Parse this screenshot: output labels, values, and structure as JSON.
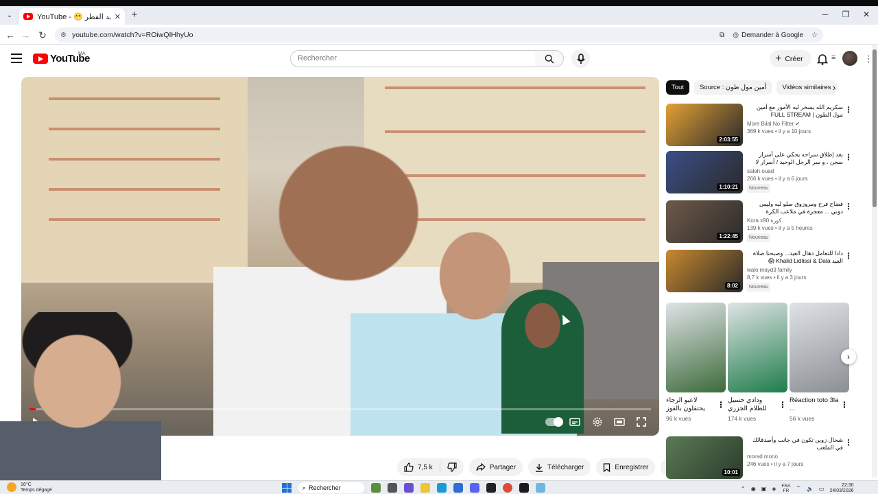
{
  "browser": {
    "tab_title": "YouTube - 😬 اجواء عيد الفطر",
    "url": "youtube.com/watch?v=ROiwQIHhyUo",
    "ask_google": "Demander à Google",
    "profile_initial": "H"
  },
  "youtube": {
    "logo_text": "YouTube",
    "region": "MA",
    "search_placeholder": "Rechercher",
    "create_label": "Créer"
  },
  "player": {
    "progress_fraction": 0.01
  },
  "actions": {
    "likes": "7,5 k",
    "share": "Partager",
    "download": "Télécharger",
    "save": "Enregistrer"
  },
  "chips": [
    "Tout",
    "Source : أمين مول طون",
    "Vidéos similaires"
  ],
  "recommendations": [
    {
      "title": "سكريم الله يسخر ليه الأمور مع أمين مول الطون | FULL STREAM",
      "channel": "More Bilal No Filter",
      "verified": true,
      "meta": "369 k vues • il y a 10 jours",
      "duration": "2:03:55",
      "badge": "",
      "thumb": "#e3a035"
    },
    {
      "title": "بعد إطلاق سراحه يحكي على أسرار سجن ، و سر الرجل الوحيد / أسرار لا تقال",
      "channel": "salah ouad",
      "verified": false,
      "meta": "266 k vues • il y a 6 jours",
      "duration": "1:10:21",
      "badge": "Nouveau",
      "thumb": "#3a4f86"
    },
    {
      "title": "فضاح فرح ومروزوق صلو ليه وليس دوتي ... معجزة في ملاعب الكرة",
      "channel": "Kora x90 كورة",
      "verified": false,
      "meta": "139 k vues • il y a 5 heures",
      "duration": "1:22:45",
      "badge": "Nouveau",
      "thumb": "#6e5a4a"
    },
    {
      "title": "دادا للتعامل دهال العيد... وصبحنا صلاة العيد Khalid Lidlissi & Dala 😱",
      "channel": "walo mayd3 family",
      "verified": false,
      "meta": "8,7 k vues • il y a 3 jours",
      "duration": "8:02",
      "badge": "Nouveau",
      "thumb": "#c98a2e"
    }
  ],
  "shorts": [
    {
      "title": "لاعبو الرجاء يحتفلون بالفوز",
      "views": "96 k vues",
      "thumb": "#3c6b3a"
    },
    {
      "title": "ودادي حسيل للطلام الجزري",
      "views": "174 k vues",
      "thumb": "#1f7d4a"
    },
    {
      "title": "Réaction toto 3la ...",
      "views": "56 k vues",
      "thumb": "#8b8f95"
    }
  ],
  "bottom_rec": {
    "title": "شحال زوين تكون في جانب وأصدقائك في الملعب",
    "channel": "morad mono",
    "meta": "246 vues • il y a 7 jours",
    "duration": "10:01",
    "thumb": "#5a7a56"
  },
  "taskbar": {
    "weather_temp": "16°C",
    "weather_desc": "Temps dégagé",
    "search_label": "Rechercher",
    "lang_top": "FRA",
    "lang_bottom": "FR",
    "time": "22:30",
    "date": "24/03/2026"
  }
}
